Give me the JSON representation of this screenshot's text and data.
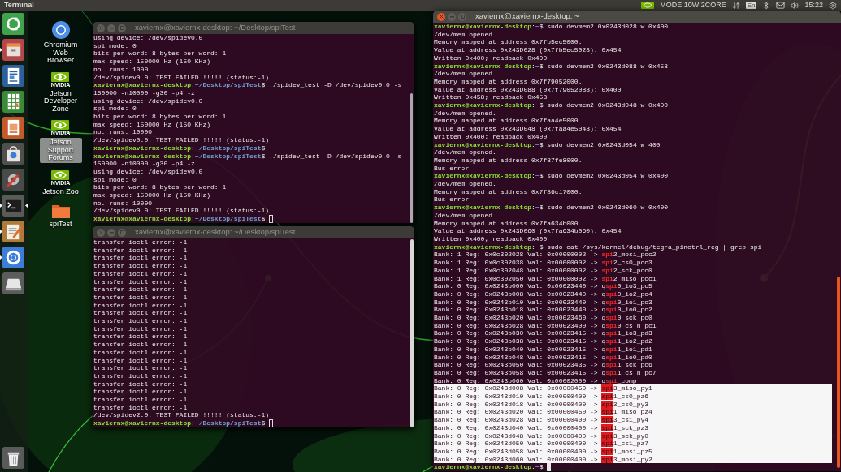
{
  "top_bar": {
    "title": "Terminal",
    "indicators": [
      {
        "kind": "nvidia"
      },
      {
        "kind": "text",
        "text": "MODE 10W 2CORE"
      },
      {
        "kind": "network"
      },
      {
        "kind": "keyboard",
        "text": "En"
      },
      {
        "kind": "bluetooth"
      },
      {
        "kind": "mail"
      },
      {
        "kind": "sound"
      },
      {
        "kind": "clock",
        "text": "15:22"
      },
      {
        "kind": "system"
      }
    ]
  },
  "launcher": [
    {
      "kind": "ubuntu",
      "running": false,
      "focused": false
    },
    {
      "kind": "files",
      "running": true,
      "focused": false
    },
    {
      "kind": "writer",
      "running": false,
      "focused": false
    },
    {
      "kind": "calc",
      "running": false,
      "focused": false
    },
    {
      "kind": "impress",
      "running": false,
      "focused": false
    },
    {
      "kind": "software",
      "running": false,
      "focused": false
    },
    {
      "kind": "settings",
      "running": false,
      "focused": false
    },
    {
      "kind": "terminal",
      "running": true,
      "focused": true
    },
    {
      "kind": "editor",
      "running": true,
      "focused": false
    },
    {
      "kind": "chromium",
      "running": true,
      "focused": false
    },
    {
      "kind": "drive",
      "running": false,
      "focused": false
    },
    {
      "kind": "trash",
      "running": false,
      "focused": false
    }
  ],
  "desktop_icons": [
    {
      "kind": "chromium",
      "label": "Chromium Web Browser",
      "selected": false
    },
    {
      "kind": "nvidia",
      "brand": "NVIDIA",
      "label": "Jetson Developer Zone",
      "selected": false
    },
    {
      "kind": "nvidia",
      "brand": "NVIDIA",
      "label": "Jetson Support Forums",
      "selected": true
    },
    {
      "kind": "nvidia",
      "brand": "NVIDIA",
      "label": "Jetson Zoo",
      "selected": false
    },
    {
      "kind": "folder",
      "label": "spiTest",
      "selected": false
    }
  ],
  "windows": [
    {
      "title": "xaviernx@xaviernx-desktop: ~/Desktop/spiTest",
      "focused": false,
      "lines": [
        {
          "kind": "output",
          "text": "using device: /dev/spidev0.0"
        },
        {
          "kind": "output",
          "text": "spi mode: 0"
        },
        {
          "kind": "output",
          "text": "bits per word: 8 bytes per word: 1"
        },
        {
          "kind": "output",
          "text": "max speed: 150000 Hz (150 KHz)"
        },
        {
          "kind": "output",
          "text": "no. runs: 1000"
        },
        {
          "kind": "output",
          "text": "/dev/spidev0.0: TEST FAILED !!!!! (status:-1)"
        },
        {
          "kind": "prompt",
          "user_host": "xaviernx@xaviernx-desktop",
          "colon": ":",
          "path": "~/Desktop/spiTest",
          "dollar": "$",
          "command": "./spidev_test -D /dev/spidev0.0 -s 150000 -n10000 -g30 -p4 -z"
        },
        {
          "kind": "output",
          "text": "using device: /dev/spidev0.0"
        },
        {
          "kind": "output",
          "text": "spi mode: 0"
        },
        {
          "kind": "output",
          "text": "bits per word: 8 bytes per word: 1"
        },
        {
          "kind": "output",
          "text": "max speed: 150000 Hz (150 KHz)"
        },
        {
          "kind": "output",
          "text": "no. runs: 10000"
        },
        {
          "kind": "output",
          "text": "/dev/spidev0.0: TEST FAILED !!!!! (status:-1)"
        },
        {
          "kind": "prompt",
          "user_host": "xaviernx@xaviernx-desktop",
          "colon": ":",
          "path": "~/Desktop/spiTest",
          "dollar": "$"
        },
        {
          "kind": "prompt",
          "user_host": "xaviernx@xaviernx-desktop",
          "colon": ":",
          "path": "~/Desktop/spiTest",
          "dollar": "$",
          "command": "./spidev_test -D /dev/spidev0.0 -s 150000 -n10000 -g30 -p4 -z"
        },
        {
          "kind": "output",
          "text": "using device: /dev/spidev0.0"
        },
        {
          "kind": "output",
          "text": "spi mode: 0"
        },
        {
          "kind": "output",
          "text": "bits per word: 8 bytes per word: 1"
        },
        {
          "kind": "output",
          "text": "max speed: 150000 Hz (150 KHz)"
        },
        {
          "kind": "output",
          "text": "no. runs: 10000"
        },
        {
          "kind": "output",
          "text": "/dev/spidev0.0: TEST FAILED !!!!! (status:-1)"
        },
        {
          "kind": "prompt",
          "user_host": "xaviernx@xaviernx-desktop",
          "colon": ":",
          "path": "~/Desktop/spiTest",
          "dollar": "$"
        }
      ]
    },
    {
      "title": "xaviernx@xaviernx-desktop: ~/Desktop/spiTest",
      "focused": false,
      "lines": [
        {
          "kind": "output",
          "text": "transfer ioctl error: -1"
        },
        {
          "kind": "output",
          "text": "transfer ioctl error: -1"
        },
        {
          "kind": "output",
          "text": "transfer ioctl error: -1"
        },
        {
          "kind": "output",
          "text": "transfer ioctl error: -1"
        },
        {
          "kind": "output",
          "text": "transfer ioctl error: -1"
        },
        {
          "kind": "output",
          "text": "transfer ioctl error: -1"
        },
        {
          "kind": "output",
          "text": "transfer ioctl error: -1"
        },
        {
          "kind": "output",
          "text": "transfer ioctl error: -1"
        },
        {
          "kind": "output",
          "text": "transfer ioctl error: -1"
        },
        {
          "kind": "output",
          "text": "transfer ioctl error: -1"
        },
        {
          "kind": "output",
          "text": "transfer ioctl error: -1"
        },
        {
          "kind": "output",
          "text": "transfer ioctl error: -1"
        },
        {
          "kind": "output",
          "text": "transfer ioctl error: -1"
        },
        {
          "kind": "output",
          "text": "transfer ioctl error: -1"
        },
        {
          "kind": "output",
          "text": "transfer ioctl error: -1"
        },
        {
          "kind": "output",
          "text": "transfer ioctl error: -1"
        },
        {
          "kind": "output",
          "text": "transfer ioctl error: -1"
        },
        {
          "kind": "output",
          "text": "transfer ioctl error: -1"
        },
        {
          "kind": "output",
          "text": "transfer ioctl error: -1"
        },
        {
          "kind": "output",
          "text": "transfer ioctl error: -1"
        },
        {
          "kind": "output",
          "text": "transfer ioctl error: -1"
        },
        {
          "kind": "output",
          "text": "transfer ioctl error: -1"
        },
        {
          "kind": "output",
          "text": "/dev/spidev2.0: TEST FAILED !!!!! (status:-1)"
        },
        {
          "kind": "prompt",
          "user_host": "xaviernx@xaviernx-desktop",
          "colon": ":",
          "path": "~/Desktop/spiTest",
          "dollar": "$"
        }
      ]
    },
    {
      "title": "xaviernx@xaviernx-desktop: ~",
      "focused": true,
      "lines": [
        {
          "kind": "prompt",
          "user_host": "xaviernx@xaviernx-desktop",
          "colon": ":",
          "path": "~",
          "dollar": "$",
          "command": "sudo devmem2 0x0243d028 w 0x400"
        },
        {
          "kind": "output",
          "text": "/dev/mem opened."
        },
        {
          "kind": "output",
          "text": "Memory mapped at address 0x7fb5ec5000."
        },
        {
          "kind": "output",
          "text": "Value at address 0x243D028 (0x7fb5ec5028): 0x454"
        },
        {
          "kind": "output",
          "text": "Written 0x400; readback 0x400"
        },
        {
          "kind": "prompt",
          "user_host": "xaviernx@xaviernx-desktop",
          "colon": ":",
          "path": "~",
          "dollar": "$",
          "command": "sudo devmem2 0x0243d088 w 0x458"
        },
        {
          "kind": "output",
          "text": "/dev/mem opened."
        },
        {
          "kind": "output",
          "text": "Memory mapped at address 0x7f79052000."
        },
        {
          "kind": "output",
          "text": "Value at address 0x243D088 (0x7f79052088): 0x400"
        },
        {
          "kind": "output",
          "text": "Written 0x458; readback 0x458"
        },
        {
          "kind": "prompt",
          "user_host": "xaviernx@xaviernx-desktop",
          "colon": ":",
          "path": "~",
          "dollar": "$",
          "command": "sudo devmem2 0x0243d048 w 0x400"
        },
        {
          "kind": "output",
          "text": "/dev/mem opened."
        },
        {
          "kind": "output",
          "text": "Memory mapped at address 0x7faa4e5000."
        },
        {
          "kind": "output",
          "text": "Value at address 0x243D048 (0x7faa4e5048): 0x454"
        },
        {
          "kind": "output",
          "text": "Written 0x400; readback 0x400"
        },
        {
          "kind": "prompt",
          "user_host": "xaviernx@xaviernx-desktop",
          "colon": ":",
          "path": "~",
          "dollar": "$",
          "command": "sudo devmem2 0x0243d054 w 400"
        },
        {
          "kind": "output",
          "text": "/dev/mem opened."
        },
        {
          "kind": "output",
          "text": "Memory mapped at address 0x7f87fe8000."
        },
        {
          "kind": "output",
          "text": "Bus error"
        },
        {
          "kind": "prompt",
          "user_host": "xaviernx@xaviernx-desktop",
          "colon": ":",
          "path": "~",
          "dollar": "$",
          "command": "sudo devmem2 0x0243d054 w 0x400"
        },
        {
          "kind": "output",
          "text": "/dev/mem opened."
        },
        {
          "kind": "output",
          "text": "Memory mapped at address 0x7f86c17000."
        },
        {
          "kind": "output",
          "text": "Bus error"
        },
        {
          "kind": "prompt",
          "user_host": "xaviernx@xaviernx-desktop",
          "colon": ":",
          "path": "~",
          "dollar": "$",
          "command": "sudo devmem2 0x0243d060 w 0x400"
        },
        {
          "kind": "output",
          "text": "/dev/mem opened."
        },
        {
          "kind": "output",
          "text": "Memory mapped at address 0x7fa634b000."
        },
        {
          "kind": "output",
          "text": "Value at address 0x243D060 (0x7fa634b060): 0x454"
        },
        {
          "kind": "output",
          "text": "Written 0x400; readback 0x400"
        },
        {
          "kind": "prompt",
          "user_host": "xaviernx@xaviernx-desktop",
          "colon": ":",
          "path": "~",
          "dollar": "$",
          "command": "sudo cat /sys/kernel/debug/tegra_pinctrl_reg | grep spi"
        },
        {
          "kind": "match",
          "before": "Bank: 1 Reg: 0x0c302028 Val: 0x00000002 -> ",
          "match": "spi",
          "after": "2_mosi_pcc2",
          "selected": false
        },
        {
          "kind": "match",
          "before": "Bank: 1 Reg: 0x0c302038 Val: 0x00000002 -> ",
          "match": "spi",
          "after": "2_cs0_pcc3",
          "selected": false
        },
        {
          "kind": "match",
          "before": "Bank: 1 Reg: 0x0c302048 Val: 0x00000002 -> ",
          "match": "spi",
          "after": "2_sck_pcc0",
          "selected": false
        },
        {
          "kind": "match",
          "before": "Bank: 1 Reg: 0x0c302050 Val: 0x00000002 -> ",
          "match": "spi",
          "after": "2_miso_pcc1",
          "selected": false
        },
        {
          "kind": "match",
          "before": "Bank: 0 Reg: 0x0243b000 Val: 0x00023440 -> q",
          "match": "spi",
          "after": "0_io3_pc5",
          "selected": false
        },
        {
          "kind": "match",
          "before": "Bank: 0 Reg: 0x0243b008 Val: 0x00023440 -> q",
          "match": "spi",
          "after": "0_io2_pc4",
          "selected": false
        },
        {
          "kind": "match",
          "before": "Bank: 0 Reg: 0x0243b010 Val: 0x00023440 -> q",
          "match": "spi",
          "after": "0_io1_pc3",
          "selected": false
        },
        {
          "kind": "match",
          "before": "Bank: 0 Reg: 0x0243b018 Val: 0x00023440 -> q",
          "match": "spi",
          "after": "0_io0_pc2",
          "selected": false
        },
        {
          "kind": "match",
          "before": "Bank: 0 Reg: 0x0243b020 Val: 0x00023460 -> q",
          "match": "spi",
          "after": "0_sck_pc0",
          "selected": false
        },
        {
          "kind": "match",
          "before": "Bank: 0 Reg: 0x0243b028 Val: 0x00023400 -> q",
          "match": "spi",
          "after": "0_cs_n_pc1",
          "selected": false
        },
        {
          "kind": "match",
          "before": "Bank: 0 Reg: 0x0243b030 Val: 0x00023415 -> q",
          "match": "spi",
          "after": "1_io3_pd3",
          "selected": false
        },
        {
          "kind": "match",
          "before": "Bank: 0 Reg: 0x0243b038 Val: 0x00023415 -> q",
          "match": "spi",
          "after": "1_io2_pd2",
          "selected": false
        },
        {
          "kind": "match",
          "before": "Bank: 0 Reg: 0x0243b040 Val: 0x00023415 -> q",
          "match": "spi",
          "after": "1_io1_pd1",
          "selected": false
        },
        {
          "kind": "match",
          "before": "Bank: 0 Reg: 0x0243b048 Val: 0x00023415 -> q",
          "match": "spi",
          "after": "1_io0_pd0",
          "selected": false
        },
        {
          "kind": "match",
          "before": "Bank: 0 Reg: 0x0243b050 Val: 0x00023435 -> q",
          "match": "spi",
          "after": "1_sck_pc6",
          "selected": false
        },
        {
          "kind": "match",
          "before": "Bank: 0 Reg: 0x0243b058 Val: 0x00023415 -> q",
          "match": "spi",
          "after": "1_cs_n_pc7",
          "selected": false
        },
        {
          "kind": "match",
          "before": "Bank: 0 Reg: 0x0243b060 Val: 0x00002000 -> q",
          "match": "spi",
          "after": "_comp",
          "selected": false
        },
        {
          "kind": "match",
          "before": "Bank: 0 Reg: 0x0243d008 Val: 0x00000450 -> ",
          "match": "spi",
          "after": "3_miso_py1",
          "selected": true
        },
        {
          "kind": "match",
          "before": "Bank: 0 Reg: 0x0243d010 Val: 0x00000400 -> ",
          "match": "spi",
          "after": "1_cs0_pz6",
          "selected": true
        },
        {
          "kind": "match",
          "before": "Bank: 0 Reg: 0x0243d018 Val: 0x00000400 -> ",
          "match": "spi",
          "after": "3_cs0_py3",
          "selected": true
        },
        {
          "kind": "match",
          "before": "Bank: 0 Reg: 0x0243d020 Val: 0x00000450 -> ",
          "match": "spi",
          "after": "1_miso_pz4",
          "selected": true
        },
        {
          "kind": "match",
          "before": "Bank: 0 Reg: 0x0243d028 Val: 0x00000400 -> ",
          "match": "spi",
          "after": "3_cs1_py4",
          "selected": true
        },
        {
          "kind": "match",
          "before": "Bank: 0 Reg: 0x0243d040 Val: 0x00000400 -> ",
          "match": "spi",
          "after": "1_sck_pz3",
          "selected": true
        },
        {
          "kind": "match",
          "before": "Bank: 0 Reg: 0x0243d048 Val: 0x00000400 -> ",
          "match": "spi",
          "after": "3_sck_py0",
          "selected": true
        },
        {
          "kind": "match",
          "before": "Bank: 0 Reg: 0x0243d050 Val: 0x00000400 -> ",
          "match": "spi",
          "after": "1_cs1_pz7",
          "selected": true
        },
        {
          "kind": "match",
          "before": "Bank: 0 Reg: 0x0243d058 Val: 0x00000400 -> ",
          "match": "spi",
          "after": "1_mosi_pz5",
          "selected": true
        },
        {
          "kind": "match",
          "before": "Bank: 0 Reg: 0x0243d060 Val: 0x00000400 -> ",
          "match": "spi",
          "after": "3_mosi_py2",
          "selected": true
        },
        {
          "kind": "prompt",
          "user_host": "xaviernx@xaviernx-desktop",
          "colon": ":",
          "path": "~",
          "dollar": "$"
        }
      ]
    }
  ]
}
